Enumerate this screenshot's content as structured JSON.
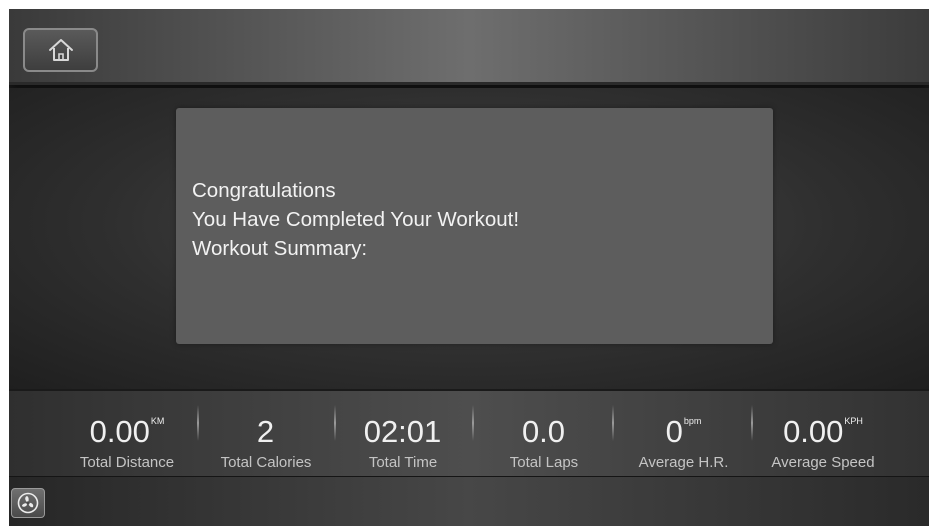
{
  "header": {
    "home_icon": "home-icon"
  },
  "message": {
    "line1": "Congratulations",
    "line2": "You Have Completed Your Workout!",
    "line3": "Workout Summary:"
  },
  "stats": [
    {
      "value": "0.00",
      "unit": "KM",
      "label": "Total Distance"
    },
    {
      "value": "2",
      "unit": "",
      "label": "Total Calories"
    },
    {
      "value": "02:01",
      "unit": "",
      "label": "Total Time"
    },
    {
      "value": "0.0",
      "unit": "",
      "label": "Total Laps"
    },
    {
      "value": "0",
      "unit": "bpm",
      "label": "Average H.R."
    },
    {
      "value": "0.00",
      "unit": "KPH",
      "label": "Average Speed"
    }
  ],
  "footer": {
    "fan_icon": "fan-icon"
  }
}
